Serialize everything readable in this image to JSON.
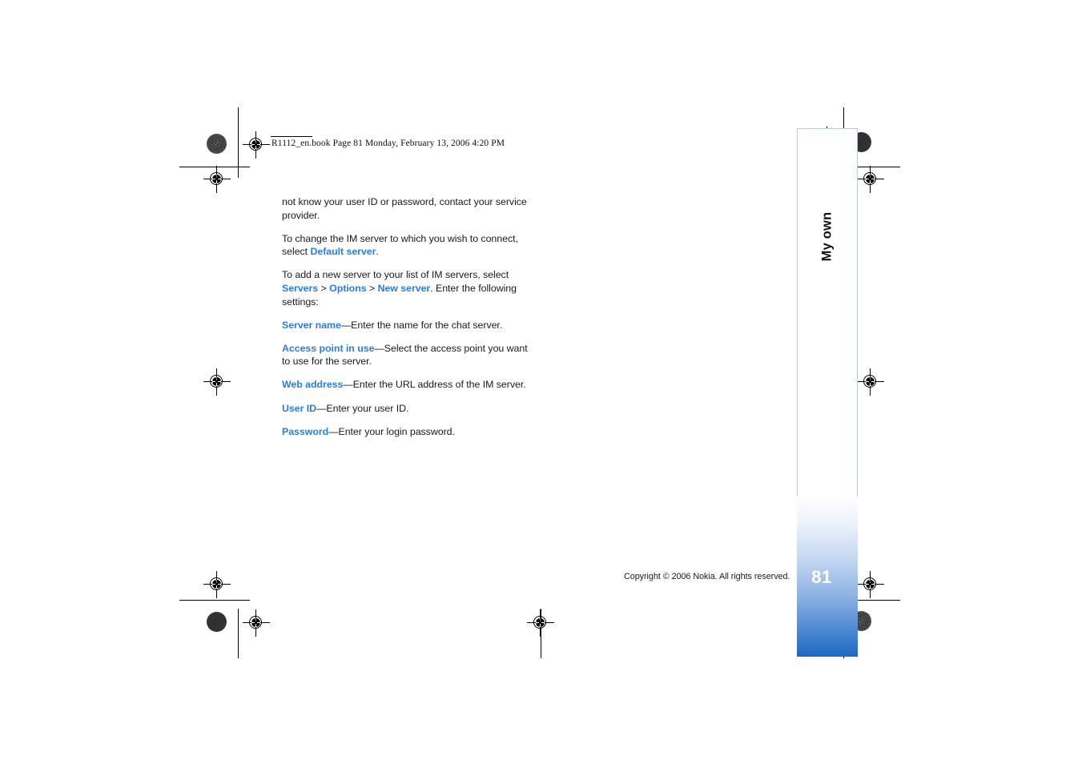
{
  "header": {
    "file_info": "R1112_en.book  Page 81  Monday, February 13, 2006  4:20 PM"
  },
  "body": {
    "paragraphs": [
      {
        "id": "p1",
        "runs": [
          {
            "type": "text",
            "value": "not know your user ID or password, contact your service provider."
          }
        ]
      },
      {
        "id": "p2",
        "runs": [
          {
            "type": "text",
            "value": "To change the IM server to which you wish to connect, select "
          },
          {
            "type": "link",
            "value": "Default server"
          },
          {
            "type": "text",
            "value": "."
          }
        ]
      },
      {
        "id": "p3",
        "runs": [
          {
            "type": "text",
            "value": "To add a new server to your list of IM servers, select "
          },
          {
            "type": "link",
            "value": "Servers"
          },
          {
            "type": "text",
            "value": " > "
          },
          {
            "type": "link",
            "value": "Options"
          },
          {
            "type": "text",
            "value": " > "
          },
          {
            "type": "link",
            "value": "New server"
          },
          {
            "type": "text",
            "value": ". Enter the following settings:"
          }
        ]
      },
      {
        "id": "p4",
        "runs": [
          {
            "type": "link",
            "value": "Server name"
          },
          {
            "type": "text",
            "value": "—Enter the name for the chat server."
          }
        ]
      },
      {
        "id": "p5",
        "runs": [
          {
            "type": "link",
            "value": "Access point in use"
          },
          {
            "type": "text",
            "value": "—Select the access point you want to use for the server."
          }
        ]
      },
      {
        "id": "p6",
        "runs": [
          {
            "type": "link",
            "value": "Web address"
          },
          {
            "type": "text",
            "value": "—Enter the URL address of the IM server."
          }
        ]
      },
      {
        "id": "p7",
        "runs": [
          {
            "type": "link",
            "value": "User ID"
          },
          {
            "type": "text",
            "value": "—Enter your user ID."
          }
        ]
      },
      {
        "id": "p8",
        "runs": [
          {
            "type": "link",
            "value": "Password"
          },
          {
            "type": "text",
            "value": "—Enter your login password."
          }
        ]
      }
    ]
  },
  "chapter_tab": {
    "label": "My own",
    "page_number": "81"
  },
  "footer": {
    "copyright": "Copyright © 2006 Nokia. All rights reserved."
  },
  "colors": {
    "link_blue": "#2a7de1",
    "tab_border": "#b9cbe8",
    "tab_gradient_bottom": "#1e68c4",
    "text": "#1a1a1a"
  }
}
